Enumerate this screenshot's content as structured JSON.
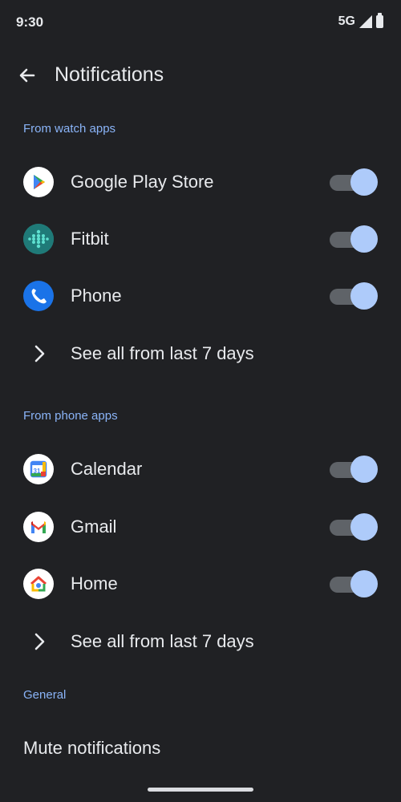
{
  "status_bar": {
    "time": "9:30",
    "network": "5G"
  },
  "app_bar": {
    "title": "Notifications"
  },
  "sections": {
    "watch": {
      "header": "From watch apps",
      "apps": [
        {
          "name": "Google Play Store",
          "icon": "google-play-icon",
          "enabled": true
        },
        {
          "name": "Fitbit",
          "icon": "fitbit-icon",
          "enabled": true
        },
        {
          "name": "Phone",
          "icon": "phone-icon",
          "enabled": true
        }
      ],
      "see_all": "See all from last 7 days"
    },
    "phone": {
      "header": "From phone apps",
      "apps": [
        {
          "name": "Calendar",
          "icon": "calendar-icon",
          "enabled": true
        },
        {
          "name": "Gmail",
          "icon": "gmail-icon",
          "enabled": true
        },
        {
          "name": "Home",
          "icon": "google-home-icon",
          "enabled": true
        }
      ],
      "see_all": "See all from last 7 days"
    },
    "general": {
      "header": "General",
      "mute_label": "Mute notifications"
    }
  },
  "colors": {
    "background": "#202124",
    "accent": "#8ab4f8",
    "toggle_thumb_on": "#aecbfa",
    "toggle_track_on": "#5f6368"
  }
}
